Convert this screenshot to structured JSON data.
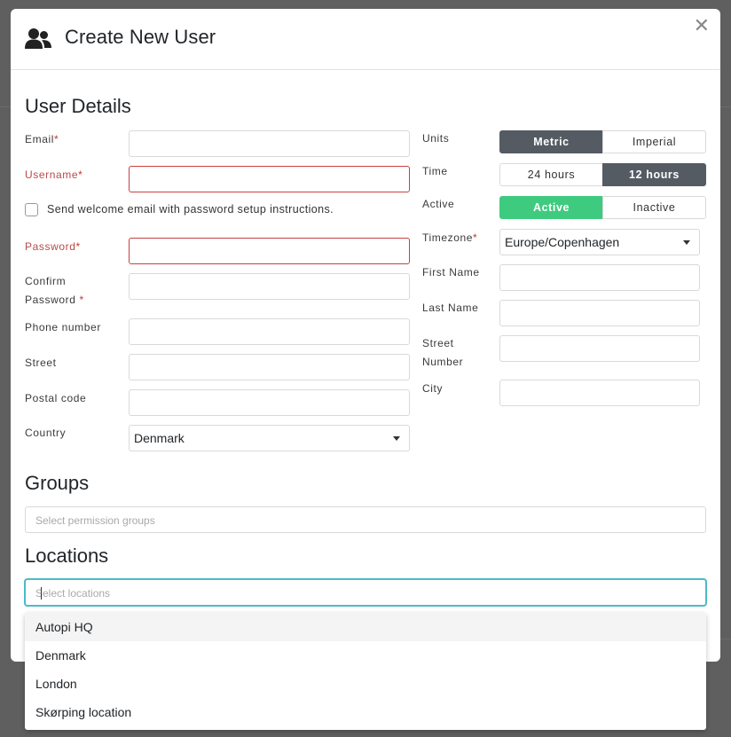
{
  "modal": {
    "title": "Create New User",
    "close_glyph": "✕",
    "header_icon": "users-icon"
  },
  "user_details": {
    "title": "User Details",
    "email_label": "Email",
    "username_label": "Username",
    "welcome_checkbox_label": "Send welcome email with password setup instructions.",
    "welcome_checked": false,
    "password_label": "Password",
    "confirm_label_line1": "Confirm",
    "confirm_label_line2": "Password",
    "phone_label": "Phone number",
    "street_label": "Street",
    "postal_label": "Postal code",
    "country_label": "Country",
    "country_value": "Denmark",
    "required_mark": "*",
    "units_label": "Units",
    "units_options": [
      "Metric",
      "Imperial"
    ],
    "units_selected": "Metric",
    "time_label": "Time",
    "time_options": [
      "24 hours",
      "12 hours"
    ],
    "time_selected": "12 hours",
    "active_label": "Active",
    "active_options": [
      "Active",
      "Inactive"
    ],
    "active_selected": "Active",
    "timezone_label": "Timezone",
    "timezone_value": "Europe/Copenhagen",
    "first_name_label": "First Name",
    "last_name_label": "Last Name",
    "street_number_label_line1": "Street",
    "street_number_label_line2": "Number",
    "city_label": "City"
  },
  "groups": {
    "title": "Groups",
    "placeholder": "Select permission groups"
  },
  "locations": {
    "title": "Locations",
    "placeholder": "Select locations",
    "options": [
      "Autopi HQ",
      "Denmark",
      "London",
      "Skørping location"
    ],
    "highlighted": "Autopi HQ"
  },
  "colors": {
    "dark_toggle": "#555b63",
    "green_toggle": "#3fcb7f",
    "error": "#c94040",
    "focus": "#4cbac6"
  }
}
